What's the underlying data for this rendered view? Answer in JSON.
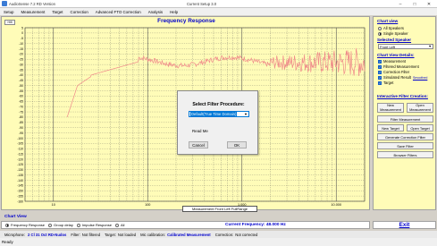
{
  "window": {
    "title": "AudioSense 7.2 RD Version",
    "document": "Current Setup 3.0",
    "min_glyph": "–",
    "max_glyph": "□",
    "close_glyph": "✕"
  },
  "menu": [
    "Setup",
    "Measurement",
    "Target",
    "Correction",
    "Advanced FTO Correction",
    "Analysis",
    "Help"
  ],
  "graph": {
    "title": "Frequency Response",
    "hifi_label": "Hifi",
    "min_label": "Min",
    "y_ticks": [
      "5",
      "0",
      "-5",
      "-10",
      "-15",
      "-20",
      "-25",
      "-30",
      "-35",
      "-40",
      "-45",
      "-50",
      "-55",
      "-60",
      "-65",
      "-70",
      "-75",
      "-80",
      "-85",
      "-90",
      "-95",
      "-100",
      "-105",
      "-110",
      "-115",
      "-120",
      "-125",
      "-130",
      "-135",
      "-140",
      "-145",
      "-150",
      "-155",
      "-160"
    ],
    "x_ticks": [
      "10",
      "100",
      "1.000",
      "10.000"
    ],
    "x_label": "Frequency Hz",
    "legend": "Measurement Front Left  FullRange",
    "colors": {
      "curve": "#f08a8a",
      "grid": "#555555",
      "bg": "#fffcb8"
    }
  },
  "dialog": {
    "title": "Select Filter Procedure:",
    "selected": "Default(True Time Domain)",
    "readme": "Read Me",
    "cancel": "Cancel",
    "ok": "OK",
    "arrow": "▼"
  },
  "right_panel": {
    "chart_view": "Chart view",
    "all_speakers": "All Speakers",
    "single_speaker": "Single Speaker",
    "selected_speaker": "Selected Speaker",
    "speaker_value": "Front Left",
    "arrow": "▼",
    "chart_view_details": "Chart View Details:",
    "details": [
      {
        "label": "Measurement",
        "checked": true
      },
      {
        "label": "Filtered Measurement",
        "checked": true
      },
      {
        "label": "Correction Filter",
        "checked": true
      },
      {
        "label": "Simulated Result",
        "checked": true
      },
      {
        "label": "Target",
        "checked": true
      }
    ],
    "smoothed": "Smoothed",
    "check_glyph": "✓",
    "interactive": "Interactive Filter Creation:",
    "new_measurement": [
      "New",
      "Measurement"
    ],
    "open_measurement": [
      "Open",
      "Measurement"
    ],
    "filter_measurement": "Filter Measurement",
    "new_target": "New Target",
    "open_target": "Open Target",
    "generate": "Generate Correction Filter",
    "save_filter": "Save Filter",
    "browse": "Browser Filters"
  },
  "chart_view_bar": {
    "label": "Chart View",
    "options": [
      {
        "label": "Frequency Response",
        "selected": true
      },
      {
        "label": "Group delay",
        "selected": false
      },
      {
        "label": "Impulse Response",
        "selected": false
      },
      {
        "label": "All",
        "selected": false
      }
    ],
    "current_frequency": "Current Frequency: 48.000 Hz"
  },
  "exit_label": "Exit",
  "info_bar": {
    "mic_label": "Microphone:",
    "mic_value": "2 Cl 31 Oct RD-Nudos",
    "filter_label": "Filter:",
    "filter_value": "Not filtered",
    "target_label": "Target:",
    "target_value": "Not loaded",
    "calib_label": "Mic calibration:",
    "calib_value": "Calibrated Measurement",
    "correction_label": "Correction:",
    "correction_value": "Not corrected"
  },
  "status": "Ready"
}
